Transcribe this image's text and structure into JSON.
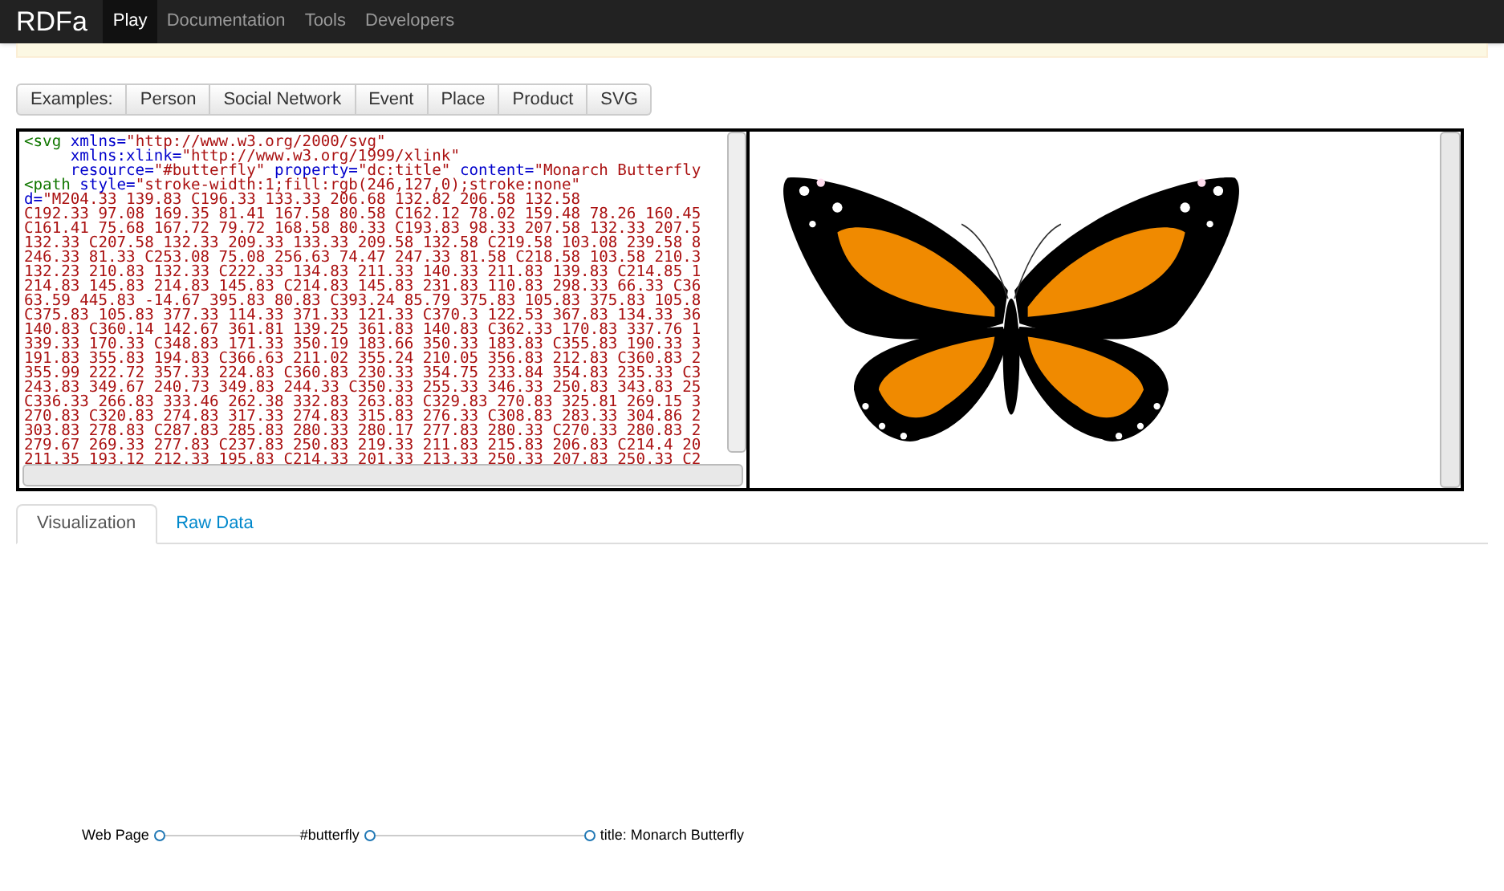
{
  "navbar": {
    "brand": "RDFa",
    "items": [
      {
        "label": "Play",
        "selected": true
      },
      {
        "label": "Documentation",
        "selected": false
      },
      {
        "label": "Tools",
        "selected": false
      },
      {
        "label": "Developers",
        "selected": false
      }
    ]
  },
  "examples": {
    "label": "Examples:",
    "buttons": [
      "Person",
      "Social Network",
      "Event",
      "Place",
      "Product",
      "SVG"
    ]
  },
  "code_editor": {
    "lines": [
      [
        {
          "kind": "tag",
          "text": "<svg "
        },
        {
          "kind": "attr",
          "text": "xmlns="
        },
        {
          "kind": "value",
          "text": "\"http://www.w3.org/2000/svg\""
        }
      ],
      [
        {
          "kind": "indent-attr",
          "text": "xmlns:xlink="
        },
        {
          "kind": "value",
          "text": "\"http://www.w3.org/1999/xlink\""
        }
      ],
      [
        {
          "kind": "indent-attr",
          "text": "resource="
        },
        {
          "kind": "value",
          "text": "\"#butterfly\" "
        },
        {
          "kind": "attr",
          "text": "property="
        },
        {
          "kind": "value",
          "text": "\"dc:title\" "
        },
        {
          "kind": "attr",
          "text": "content="
        },
        {
          "kind": "value",
          "text": "\"Monarch Butterfly"
        }
      ],
      [
        {
          "kind": "tag",
          "text": "<path "
        },
        {
          "kind": "attr",
          "text": "style="
        },
        {
          "kind": "value",
          "text": "\"stroke-width:1;fill:rgb(246,127,0);stroke:none\""
        }
      ],
      [
        {
          "kind": "attr",
          "text": "d="
        },
        {
          "kind": "value",
          "text": "\"M204.33 139.83 C196.33 133.33 206.68 132.82 206.58 132.58"
        }
      ],
      [
        {
          "kind": "value",
          "text": "C192.33 97.08 169.35 81.41 167.58 80.58 C162.12 78.02 159.48 78.26 160.45"
        }
      ],
      [
        {
          "kind": "value",
          "text": "C161.41 75.68 167.72 79.72 168.58 80.33 C193.83 98.33 207.58 132.33 207.5"
        }
      ],
      [
        {
          "kind": "value",
          "text": "132.33 C207.58 132.33 209.33 133.33 209.58 132.58 C219.58 103.08 239.58 8"
        }
      ],
      [
        {
          "kind": "value",
          "text": "246.33 81.33 C253.08 75.08 256.63 74.47 247.33 81.58 C218.58 103.58 210.3"
        }
      ],
      [
        {
          "kind": "value",
          "text": "132.23 210.83 132.33 C222.33 134.83 211.33 140.33 211.83 139.83 C214.85 1"
        }
      ],
      [
        {
          "kind": "value",
          "text": "214.83 145.83 214.83 145.83 C214.83 145.83 231.83 110.83 298.33 66.33 C36"
        }
      ],
      [
        {
          "kind": "value",
          "text": "63.59 445.83 -14.67 395.83 80.83 C393.24 85.79 375.83 105.83 375.83 105.8"
        }
      ],
      [
        {
          "kind": "value",
          "text": "C375.83 105.83 377.33 114.33 371.33 121.33 C370.3 122.53 367.83 134.33 36"
        }
      ],
      [
        {
          "kind": "value",
          "text": "140.83 C360.14 142.67 361.81 139.25 361.83 140.83 C362.33 170.83 337.76 1"
        }
      ],
      [
        {
          "kind": "value",
          "text": "339.33 170.33 C348.83 171.33 350.19 183.66 350.33 183.83 C355.83 190.33 3"
        }
      ],
      [
        {
          "kind": "value",
          "text": "191.83 355.83 194.83 C366.63 211.02 355.24 210.05 356.83 212.83 C360.83 2"
        }
      ],
      [
        {
          "kind": "value",
          "text": "355.99 222.72 357.33 224.83 C360.83 230.33 354.75 233.84 354.83 235.33 C3"
        }
      ],
      [
        {
          "kind": "value",
          "text": "243.83 349.67 240.73 349.83 244.33 C350.33 255.33 346.33 250.83 343.83 25"
        }
      ],
      [
        {
          "kind": "value",
          "text": "C336.33 266.83 333.46 262.38 332.83 263.83 C329.83 270.83 325.81 269.15 3"
        }
      ],
      [
        {
          "kind": "value",
          "text": "270.83 C320.83 274.83 317.33 274.83 315.83 276.33 C308.83 283.33 304.86 2"
        }
      ],
      [
        {
          "kind": "value",
          "text": "303.83 278.83 C287.83 285.83 280.33 280.17 277.83 280.33 C270.33 280.83 2"
        }
      ],
      [
        {
          "kind": "value",
          "text": "279.67 269.33 277.83 C237.83 250.83 219.33 211.83 215.83 206.83 C214.4 20"
        }
      ],
      [
        {
          "kind": "value",
          "text": "211.35 193.12 212.33 195.83 C214.33 201.33 213.33 250.33 207.83 250.33 C2"
        }
      ]
    ]
  },
  "result_tabs": [
    {
      "label": "Visualization",
      "selected": true
    },
    {
      "label": "Raw Data",
      "selected": false
    }
  ],
  "graph": {
    "nodes": [
      {
        "label": "Web Page",
        "kind": "resource"
      },
      {
        "label": "#butterfly",
        "kind": "resource"
      },
      {
        "label": "title: Monarch Butterfly",
        "kind": "literal"
      }
    ]
  }
}
